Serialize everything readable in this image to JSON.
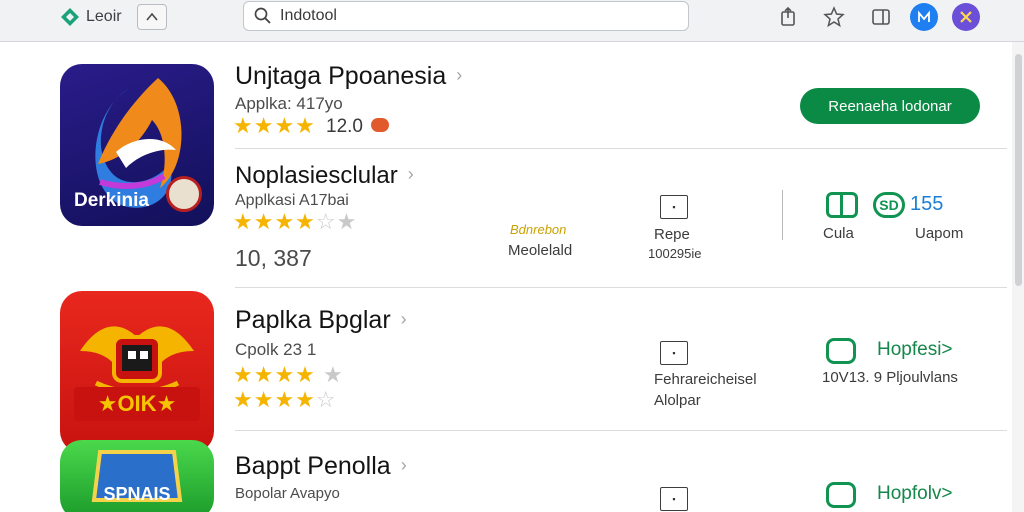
{
  "topbar": {
    "logo_text": "Leoir",
    "search_value": "Indotool",
    "search_placeholder": "Search"
  },
  "apps": [
    {
      "name": "Unjtaga Ppoanesia",
      "subtitle": "Applka: 417yo",
      "rating_text": "12.0",
      "icon_label": "Derkinia",
      "stars": 4,
      "get_label": "Reenaeha lodonar"
    },
    {
      "name": "Noplasiesclular",
      "subtitle": "Applkasi A17bai",
      "count_text": "10, 387",
      "stars": 3.5,
      "meta_yellow": "Bdnrebon",
      "meta_label": "Meolelald",
      "meta2_label": "Repe",
      "meta2_sub": "100295ie",
      "stat1_label": "Cula",
      "stat2_value": "155",
      "stat2_badge": "SD",
      "stat2_label": "Uapom"
    },
    {
      "name": "Paplka Bpglar",
      "subtitle": "Cpolk 23 1",
      "icon_label": "OIK",
      "stars": 4,
      "stars2": 4.5,
      "meta_label": "Fehrareicheisel",
      "meta_sub": "Alolpar",
      "action_label": "Hopfesi>",
      "stat_text": "10V13.  9  Pljoulvlans"
    },
    {
      "name": "Bappt Penolla",
      "subtitle": "Bopolar Avapyo",
      "icon_label": "SPNAIS",
      "action_label": "Hopfolv>"
    }
  ],
  "colors": {
    "accent_green": "#0b8a45",
    "star_yellow": "#f4b400",
    "link_blue": "#1c7fd6",
    "avatar_blue": "#1f7ff0",
    "avatar_purple": "#6b4fd8"
  }
}
